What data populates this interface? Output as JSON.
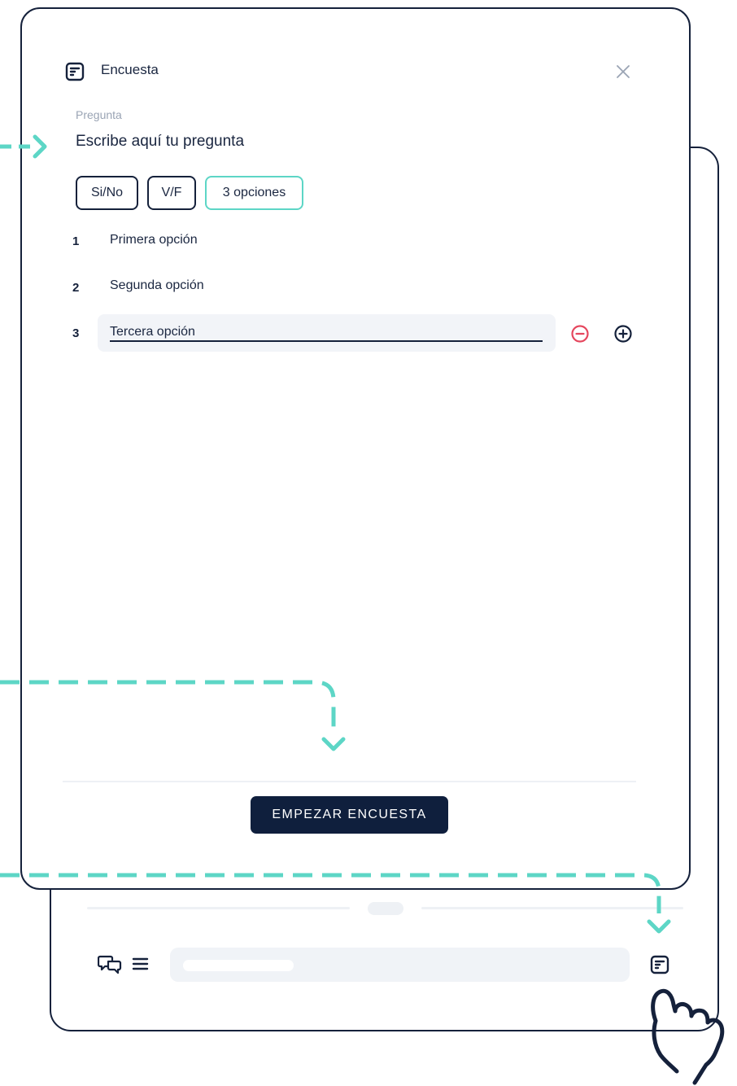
{
  "modal": {
    "title": "Encuesta",
    "title_icon": "survey-icon",
    "close_icon": "close-icon",
    "question": {
      "label": "Pregunta",
      "value": "Escribe aquí tu pregunta"
    },
    "types": [
      {
        "label": "Si/No",
        "active": false
      },
      {
        "label": "V/F",
        "active": false
      },
      {
        "label": "3 opciones",
        "active": true
      }
    ],
    "options": [
      {
        "number": "1",
        "text": "Primera opción"
      },
      {
        "number": "2",
        "text": "Segunda opción"
      },
      {
        "number": "3",
        "text": "Tercera opción"
      }
    ],
    "remove_icon": "minus-circle-icon",
    "add_icon": "plus-circle-icon",
    "start_button": "EMPEZAR ENCUESTA"
  },
  "chat_bar": {
    "chat_icon": "chat-bubbles-icon",
    "menu_icon": "hamburger-menu-icon",
    "survey_icon": "survey-icon"
  },
  "colors": {
    "accent": "#5dd6c6",
    "navy": "#0f1f3d",
    "border": "#15213b",
    "danger": "#e5475e",
    "muted": "#9aa4b4"
  }
}
